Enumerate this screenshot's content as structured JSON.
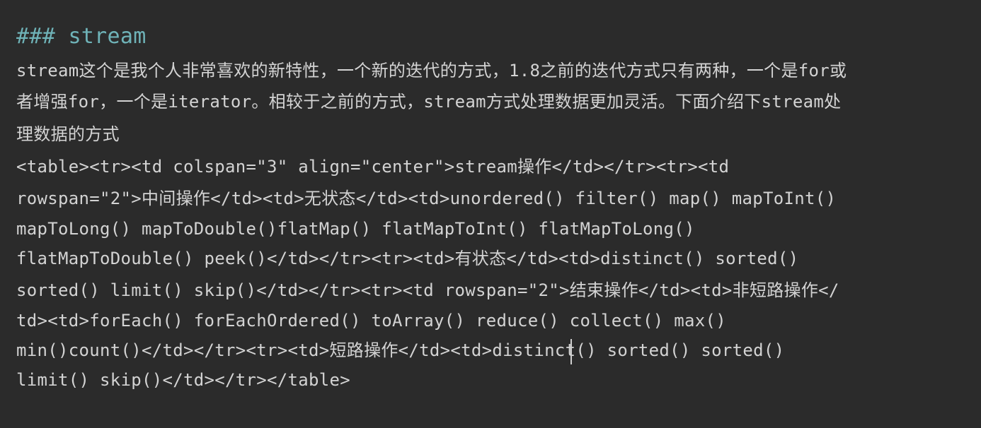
{
  "editor": {
    "heading": "### stream",
    "lines": [
      "stream这个是我个人非常喜欢的新特性，一个新的迭代的方式，1.8之前的迭代方式只有两种，一个是for或",
      "者增强for，一个是iterator。相较于之前的方式，stream方式处理数据更加灵活。下面介绍下stream处",
      "理数据的方式",
      "<table><tr><td colspan=\"3\" align=\"center\">stream操作</td></tr><tr><td",
      "rowspan=\"2\">中间操作</td><td>无状态</td><td>unordered() filter() map() mapToInt()",
      "mapToLong() mapToDouble()flatMap() flatMapToInt() flatMapToLong()",
      "flatMapToDouble() peek()</td></tr><tr><td>有状态</td><td>distinct() sorted()",
      "sorted() limit() skip()</td></tr><tr><td rowspan=\"2\">结束操作</td><td>非短路操作</",
      "td><td>forEach() forEachOrdered() toArray() reduce() collect() max()",
      "min()count()</td></tr><tr><td>短路操作</td><td>distinct() sorted() sorted()",
      "limit() skip()</td></tr></table>"
    ]
  },
  "colors": {
    "background": "#2b2b2b",
    "text": "#d3d3d3",
    "heading": "#6fb3b8"
  }
}
